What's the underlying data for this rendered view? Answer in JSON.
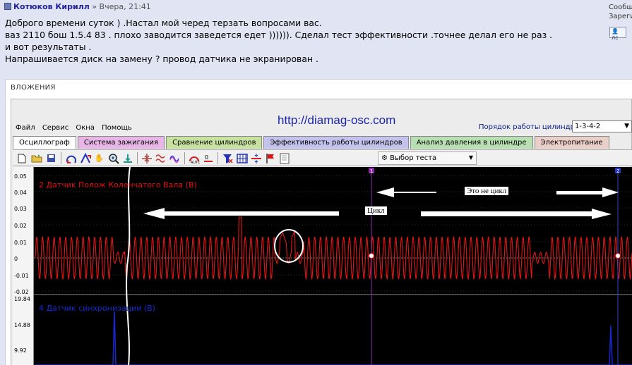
{
  "post": {
    "author": "Котюков Кирилл",
    "date": "» Вчера, 21:41",
    "lines": [
      "Доброго времени суток ) .Настал мой черед терзать вопросами вас.",
      "ваз 2110 бош 1.5.4 83 . плохо заводится заведется едет )))))). Сделал тест эффективности .точнее делал его не раз .",
      "и вот результаты .",
      "",
      "Напрашивается диск на замену ? провод датчика не экранирован ."
    ]
  },
  "sidebar": {
    "line1": "Сообщ",
    "line2": "Зареги",
    "pm_label": "лс"
  },
  "attachments": {
    "label": "ВЛОЖЕНИЯ"
  },
  "app": {
    "url": "http://diamag-osc.com",
    "menu": [
      "Файл",
      "Сервис",
      "Окна",
      "Помощь"
    ],
    "order_label": "Порядок работы цилиндров",
    "order_value": "1-3-4-2",
    "tabs": [
      {
        "label": "Осциллограф",
        "color": "#ffffff"
      },
      {
        "label": "Система зажигания",
        "color": "#e7b5e6"
      },
      {
        "label": "Сравнение цилиндров",
        "color": "#c7e2a0"
      },
      {
        "label": "Эффективность работы цилиндров",
        "color": "#c2c2ec"
      },
      {
        "label": "Анализ давления в цилиндре",
        "color": "#b8dfb1"
      },
      {
        "label": "Электропитание",
        "color": "#e9cfc7"
      }
    ],
    "test_select": "Выбор теста",
    "channel1": "2 Датчик Полож Коленчатого Вала (В)",
    "channel2": "4 Датчик синхронизации (В)",
    "yticks_top": [
      "0.05",
      "0.04",
      "0.03",
      "0.02",
      "0.01",
      "0",
      "-0.01",
      "-0.02"
    ],
    "yticks_bottom": [
      "19.84",
      "14.88",
      "9.92"
    ],
    "annotations": {
      "cycle": "Цикл",
      "not_cycle": "Это не цикл"
    },
    "marker1": "1",
    "marker2": "2",
    "colors": {
      "signal": "#e81515",
      "sync": "#1628d6",
      "cursor": "#8e2aa8"
    }
  }
}
